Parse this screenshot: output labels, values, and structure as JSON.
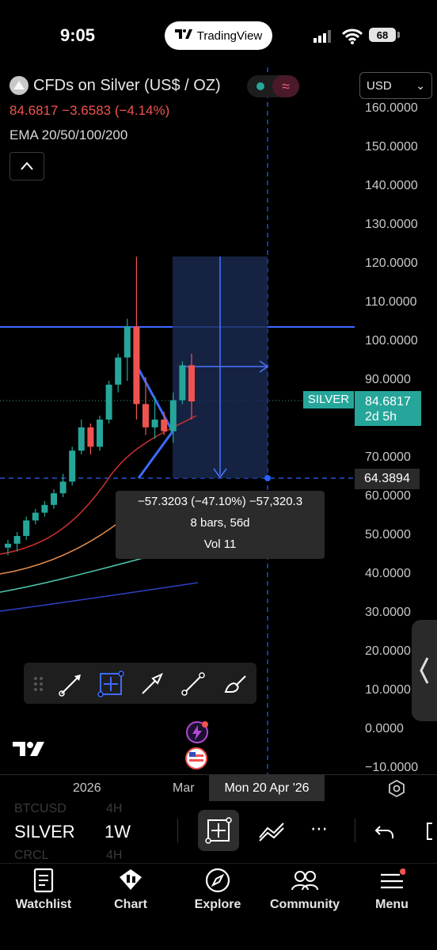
{
  "status_bar": {
    "time": "9:05",
    "app_pill": "TradingView",
    "battery": "68"
  },
  "header": {
    "title": "CFDs on Silver (US$ / OZ)",
    "price_change": "84.6817  −3.6583 (−4.14%)",
    "indicators": "EMA 20/50/100/200",
    "currency": "USD",
    "currency_chevron": "⌄"
  },
  "price_axis": {
    "ticks": [
      "160.0000",
      "150.0000",
      "140.0000",
      "130.0000",
      "120.0000",
      "110.0000",
      "100.0000",
      "90.0000",
      "80.0000",
      "70.0000",
      "60.0000",
      "50.0000",
      "40.0000",
      "30.0000",
      "20.0000",
      "10.0000",
      "0.0000",
      "−10.0000"
    ],
    "current_symbol": "SILVER",
    "current_value": "84.6817",
    "current_countdown": "2d 5h",
    "crosshair_value": "64.3894"
  },
  "measure": {
    "line1": "−57.3203 (−47.10%) −57,320.3",
    "line2": "8 bars, 56d",
    "line3": "Vol 11"
  },
  "time_axis": {
    "year": "2026",
    "month": "Mar",
    "crosshair_date": "Mon 20 Apr '26"
  },
  "ticker_bar": {
    "symbol": "SILVER",
    "interval": "1W",
    "ghost_above": "BTCUSD",
    "ghost_above_int": "4H",
    "ghost_below": "CRCL",
    "ghost_below_int": "4H",
    "more": "⋯"
  },
  "nav": [
    "Watchlist",
    "Chart",
    "Explore",
    "Community",
    "Menu"
  ],
  "colors": {
    "up": "#26a69a",
    "down": "#ef5350",
    "accent": "#2962ff",
    "background": "#000000"
  },
  "chart_data": {
    "type": "candlestick",
    "symbol": "SILVER",
    "interval": "1W",
    "ylim": [
      -10,
      160
    ],
    "candles": [
      {
        "o": 47,
        "h": 49,
        "l": 45,
        "c": 48
      },
      {
        "o": 48,
        "h": 51,
        "l": 46,
        "c": 50
      },
      {
        "o": 50,
        "h": 55,
        "l": 49,
        "c": 54
      },
      {
        "o": 54,
        "h": 57,
        "l": 53,
        "c": 56
      },
      {
        "o": 56,
        "h": 59,
        "l": 55,
        "c": 58
      },
      {
        "o": 58,
        "h": 62,
        "l": 57,
        "c": 61
      },
      {
        "o": 61,
        "h": 66,
        "l": 60,
        "c": 64
      },
      {
        "o": 64,
        "h": 73,
        "l": 63,
        "c": 72
      },
      {
        "o": 72,
        "h": 80,
        "l": 71,
        "c": 78
      },
      {
        "o": 78,
        "h": 79,
        "l": 71,
        "c": 73
      },
      {
        "o": 73,
        "h": 81,
        "l": 72,
        "c": 80
      },
      {
        "o": 80,
        "h": 90,
        "l": 79,
        "c": 89
      },
      {
        "o": 89,
        "h": 97,
        "l": 87,
        "c": 96
      },
      {
        "o": 96,
        "h": 106,
        "l": 90,
        "c": 104
      },
      {
        "o": 104,
        "h": 122,
        "l": 80,
        "c": 84
      },
      {
        "o": 84,
        "h": 91,
        "l": 76,
        "c": 78
      },
      {
        "o": 78,
        "h": 86,
        "l": 75,
        "c": 80
      },
      {
        "o": 80,
        "h": 82,
        "l": 76,
        "c": 77
      },
      {
        "o": 77,
        "h": 87,
        "l": 74,
        "c": 85
      },
      {
        "o": 85,
        "h": 95,
        "l": 84,
        "c": 94
      },
      {
        "o": 94,
        "h": 97,
        "l": 80,
        "c": 84.6817
      }
    ],
    "horizontal_line": 103,
    "measure_from": 121.7,
    "measure_to": 64.3894
  }
}
